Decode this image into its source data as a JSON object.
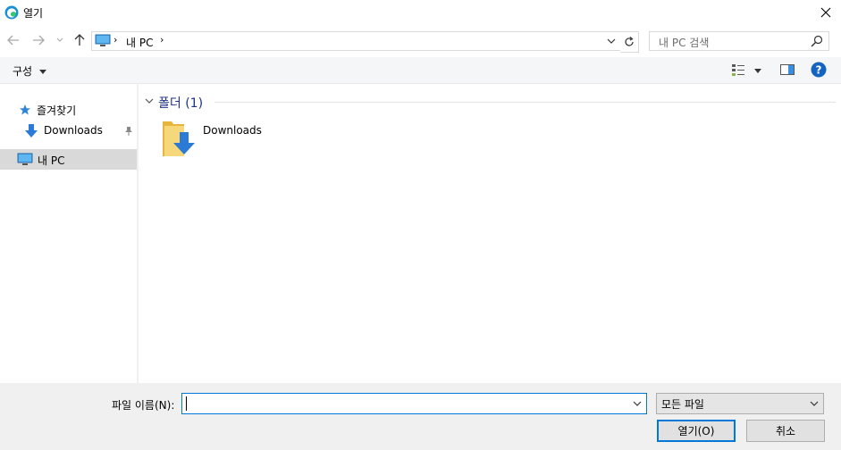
{
  "window": {
    "title": "열기"
  },
  "address": {
    "segments": [
      "내 PC"
    ]
  },
  "search": {
    "placeholder": "내 PC 검색"
  },
  "command_bar": {
    "organize_label": "구성"
  },
  "nav": {
    "items": [
      {
        "label": "즐겨찾기"
      },
      {
        "label": "Downloads"
      },
      {
        "label": "내 PC"
      }
    ]
  },
  "content": {
    "group_title": "폴더 (1)",
    "items": [
      {
        "name": "Downloads"
      }
    ]
  },
  "bottom": {
    "filename_label": "파일 이름(N):",
    "filename_value": "",
    "filetype_value": "모든 파일",
    "open_label": "열기(O)",
    "cancel_label": "취소"
  },
  "colors": {
    "accent": "#0078d7",
    "folder": "#f3c453",
    "download_arrow": "#2b7bd6",
    "selected_nav": "#d9d9d9"
  }
}
